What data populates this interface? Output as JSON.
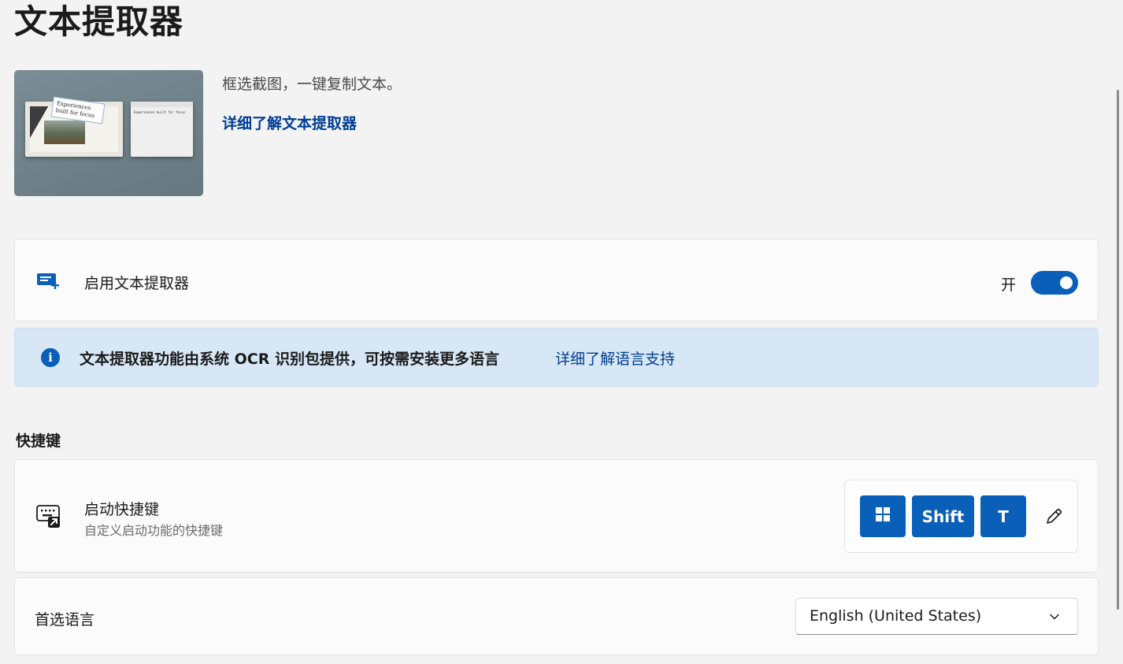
{
  "page": {
    "title": "文本提取器"
  },
  "hero": {
    "description": "框选截图，一键复制文本。",
    "learn_more": "详细了解文本提取器",
    "image": {
      "selection_text": "Experiences built for focus",
      "notepad_text": "Experiences built for focus"
    }
  },
  "enable": {
    "icon": "text-extractor-icon",
    "label": "启用文本提取器",
    "state_label": "开",
    "enabled": true
  },
  "info_bar": {
    "icon": "info-icon",
    "icon_glyph": "i",
    "message": "文本提取器功能由系统 OCR 识别包提供，可按需安装更多语言",
    "link": "详细了解语言支持"
  },
  "shortcuts": {
    "section_title": "快捷键",
    "activation": {
      "icon": "keyboard-shortcut-icon",
      "label": "启动快捷键",
      "description": "自定义启动功能的快捷键",
      "keys": [
        {
          "label": "",
          "icon": "windows-logo-icon"
        },
        {
          "label": "Shift"
        },
        {
          "label": "T"
        }
      ],
      "edit_icon": "pencil-icon"
    }
  },
  "language": {
    "label": "首选语言",
    "selected": "English (United States)",
    "icon": "chevron-down-icon"
  },
  "colors": {
    "accent": "#0a5fb8",
    "link": "#003e92",
    "info_background": "#d7e7f5",
    "page_background": "#f3f3f3"
  }
}
